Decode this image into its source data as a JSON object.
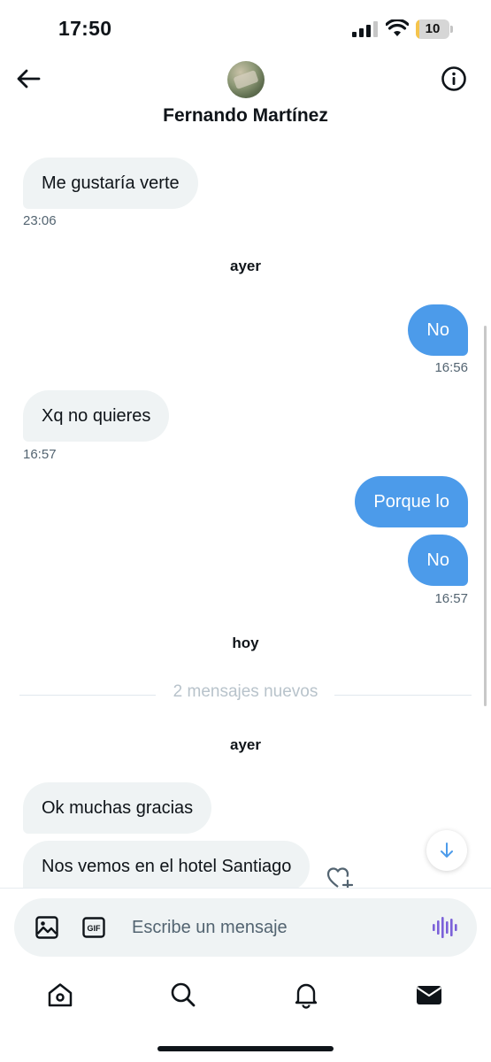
{
  "status_bar": {
    "time": "17:50",
    "battery_level": "10",
    "battery_fraction": 0.1,
    "battery_color": "#f5c44c"
  },
  "header": {
    "contact_name": "Fernando Martínez",
    "back_icon": "arrow-left-icon",
    "info_icon": "info-icon"
  },
  "messages": [
    {
      "direction": "in",
      "text": "Me gustaría verte",
      "time": "23:06"
    },
    {
      "separator": "ayer"
    },
    {
      "direction": "out",
      "text": "No",
      "time": "16:56"
    },
    {
      "direction": "in",
      "text": "Xq no quieres",
      "time": "16:57"
    },
    {
      "direction": "out",
      "text": "Porque lo"
    },
    {
      "direction": "out",
      "text": "No",
      "time": "16:57"
    },
    {
      "separator": "hoy"
    },
    {
      "new_messages": "2 mensajes nuevos"
    },
    {
      "separator": "ayer"
    },
    {
      "direction": "in",
      "text": "Ok muchas gracias"
    },
    {
      "direction": "in",
      "text": "Nos vemos en el hotel Santiago"
    }
  ],
  "composer": {
    "placeholder": "Escribe un mensaje",
    "image_icon": "image-icon",
    "gif_icon": "gif-icon",
    "voice_icon": "voice-wave-icon"
  },
  "tabs": [
    {
      "name": "home",
      "icon": "home-icon"
    },
    {
      "name": "search",
      "icon": "search-icon"
    },
    {
      "name": "notifications",
      "icon": "bell-icon"
    },
    {
      "name": "messages",
      "icon": "envelope-icon",
      "active": true
    }
  ],
  "colors": {
    "outgoing_bubble": "#4c9bea",
    "incoming_bubble": "#eff3f4",
    "text": "#0f1419",
    "muted": "#536471",
    "voice_accent": "#7b61d9"
  }
}
